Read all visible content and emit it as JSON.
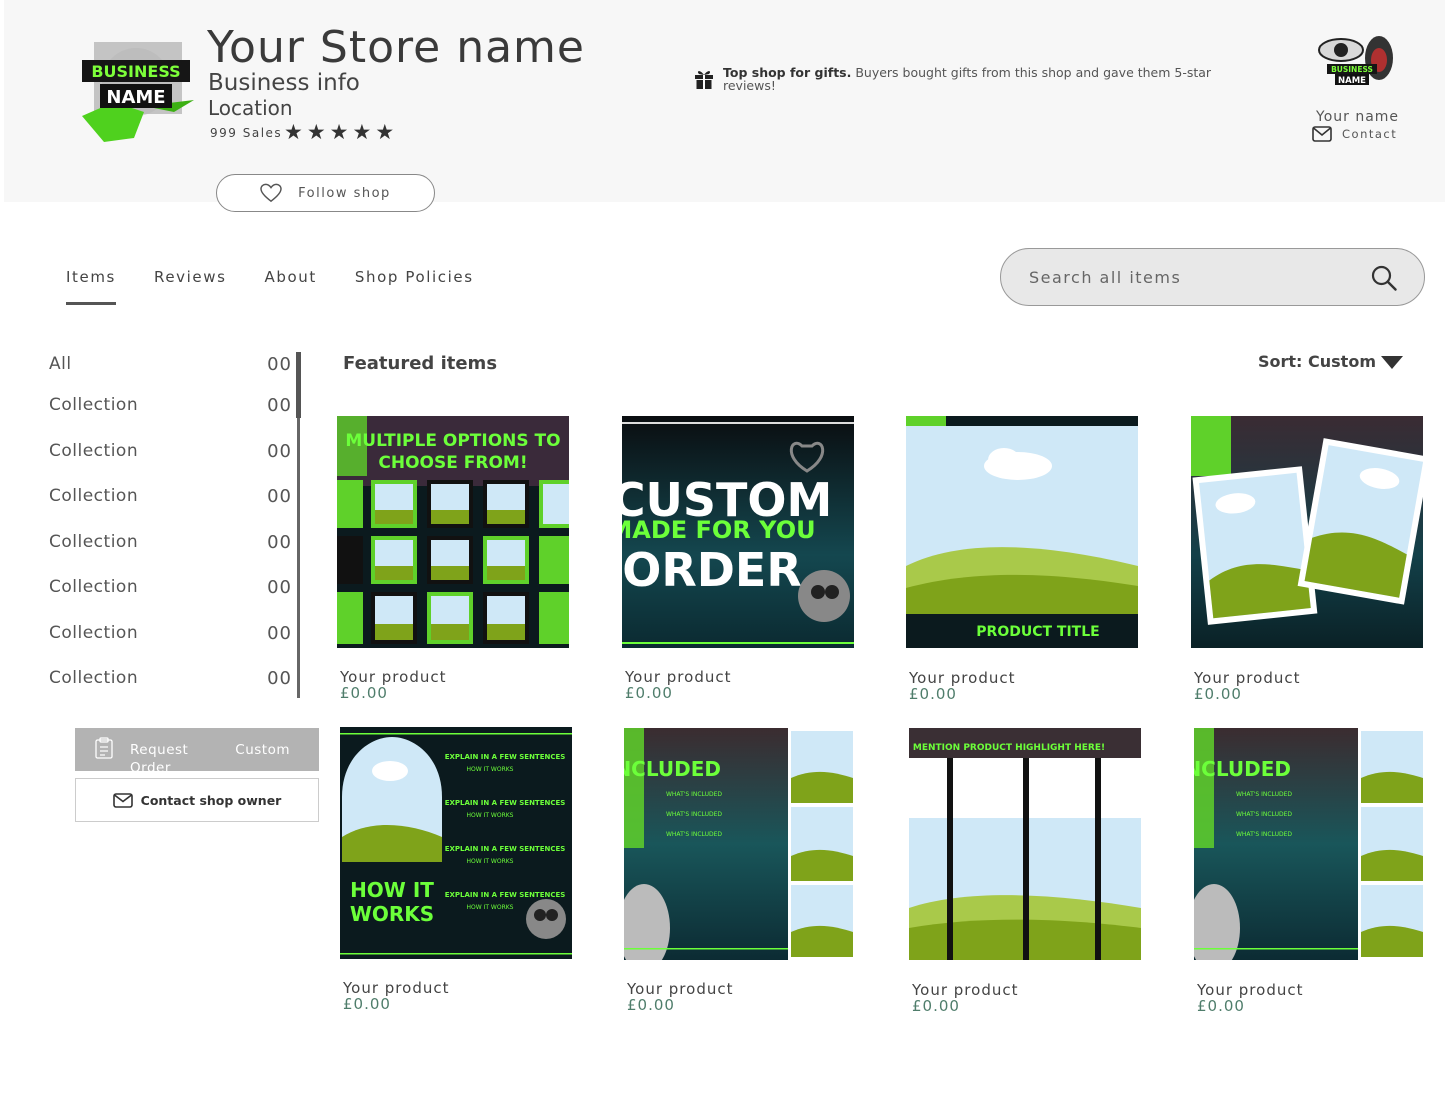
{
  "header": {
    "store_title": "Your Store name",
    "business_info": "Business info",
    "location": "Location",
    "sales": "999 Sales",
    "rating_stars": 5,
    "follow_label": "Follow shop",
    "gift_bold": "Top shop for gifts.",
    "gift_text": " Buyers bought gifts from this shop and gave them 5-star reviews!",
    "owner_name": "Your name",
    "contact_label": "Contact",
    "logo_text_1": "BUSINESS",
    "logo_text_2": "NAME"
  },
  "tabs": [
    {
      "label": "Items",
      "active": true
    },
    {
      "label": "Reviews",
      "active": false
    },
    {
      "label": "About",
      "active": false
    },
    {
      "label": "Shop Policies",
      "active": false
    }
  ],
  "search": {
    "placeholder": "Search all items"
  },
  "sidebar": {
    "items": [
      {
        "label": "All",
        "count": "00"
      },
      {
        "label": "Collection",
        "count": "00"
      },
      {
        "label": "Collection",
        "count": "00"
      },
      {
        "label": "Collection",
        "count": "00"
      },
      {
        "label": "Collection",
        "count": "00"
      },
      {
        "label": "Collection",
        "count": "00"
      },
      {
        "label": "Collection",
        "count": "00"
      },
      {
        "label": "Collection",
        "count": "00"
      }
    ],
    "request_label_1": "Request",
    "request_label_2": "Custom",
    "request_label_3": "Order",
    "contact_owner_label": "Contact shop owner"
  },
  "main": {
    "featured_title": "Featured items",
    "sort_label": "Sort: Custom",
    "products": [
      {
        "name": "Your product",
        "price": "£0.00",
        "overlay": "MULTIPLE OPTIONS TO CHOOSE FROM!"
      },
      {
        "name": "Your product",
        "price": "£0.00",
        "overlay": "CUSTOM MADE FOR YOU ORDER"
      },
      {
        "name": "Your product",
        "price": "£0.00",
        "overlay": "PRODUCT TITLE"
      },
      {
        "name": "Your product",
        "price": "£0.00",
        "overlay": ""
      },
      {
        "name": "Your product",
        "price": "£0.00",
        "overlay": "HOW IT WORKS"
      },
      {
        "name": "Your product",
        "price": "£0.00",
        "overlay": "INCLUDED"
      },
      {
        "name": "Your product",
        "price": "£0.00",
        "overlay": "MENTION PRODUCT HIGHLIGHT HERE!"
      },
      {
        "name": "Your product",
        "price": "£0.00",
        "overlay": "INCLUDED"
      }
    ]
  },
  "colors": {
    "accent_green": "#6cd43a",
    "sky": "#cfe8f7",
    "grass": "#7fa31a",
    "dark": "#0b1a1e",
    "price": "#4f7d6b"
  }
}
